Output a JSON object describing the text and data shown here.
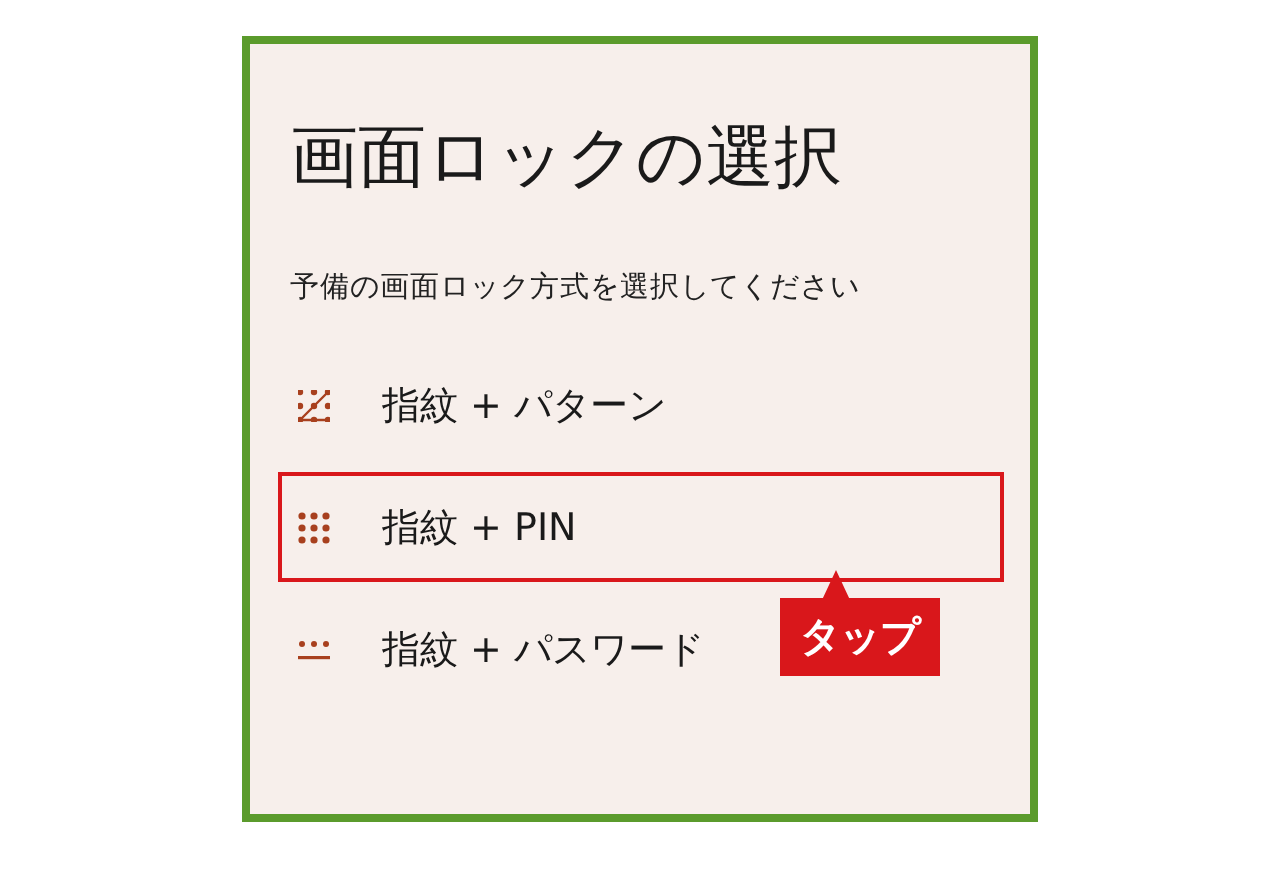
{
  "title": "画面ロックの選択",
  "subtitle": "予備の画面ロック方式を選択してください",
  "options": [
    {
      "kind": "pattern",
      "label": "指紋 + パターン",
      "highlighted": false
    },
    {
      "kind": "pin",
      "label": "指紋 + PIN",
      "highlighted": true
    },
    {
      "kind": "password",
      "label": "指紋 + パスワード",
      "highlighted": false
    }
  ],
  "callout": {
    "text": "タップ"
  }
}
